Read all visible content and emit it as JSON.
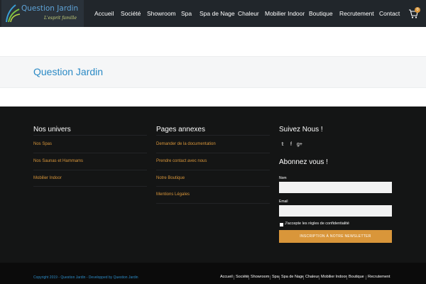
{
  "header": {
    "logo": {
      "name": "Question Jardin",
      "tagline": "L'esprit famille"
    },
    "nav": [
      "Accueil",
      "Société",
      "Showroom",
      "Spa",
      "Spa de Nage",
      "Chaleur",
      "Mobilier Indoor",
      "Boutique",
      "Recrutement",
      "Contact"
    ],
    "cart_count": "0",
    "icons": {
      "cart": "cart-icon"
    }
  },
  "page": {
    "title": "Question Jardin"
  },
  "footer": {
    "univers": {
      "title": "Nos univers",
      "links": [
        "Nos Spas",
        "Nos Saunas et Hammams",
        "Mobilier Indoor"
      ]
    },
    "annexes": {
      "title": "Pages annexes",
      "links": [
        "Demander de la documentation",
        "Prendre contact avec nous",
        "Notre Boutique",
        "Mentions Légales"
      ]
    },
    "follow": {
      "title": "Suivez Nous !",
      "icons": [
        "twitter-icon",
        "facebook-icon",
        "google-plus-icon"
      ]
    },
    "subscribe": {
      "title": "Abonnez vous !",
      "name_label": "Nom",
      "email_label": "Email",
      "consent_label": "J'accepte les règles de confidentialité",
      "button_label": "Inscription à notre newsletter"
    }
  },
  "bottom": {
    "copyright": "Copyright 2019 - Question Jardin - Developped by Question Jardin",
    "links": [
      "Accueil",
      "Société",
      "Showroom",
      "Spa",
      "Spa de Nage",
      "Chaleur",
      "Mobilier Indoor",
      "Boutique",
      "Recrutement"
    ]
  },
  "colors": {
    "accent": "#d9963a",
    "brand_blue": "#2b8ac5",
    "header_bg": "#21262b",
    "footer_bg": "#141515"
  }
}
